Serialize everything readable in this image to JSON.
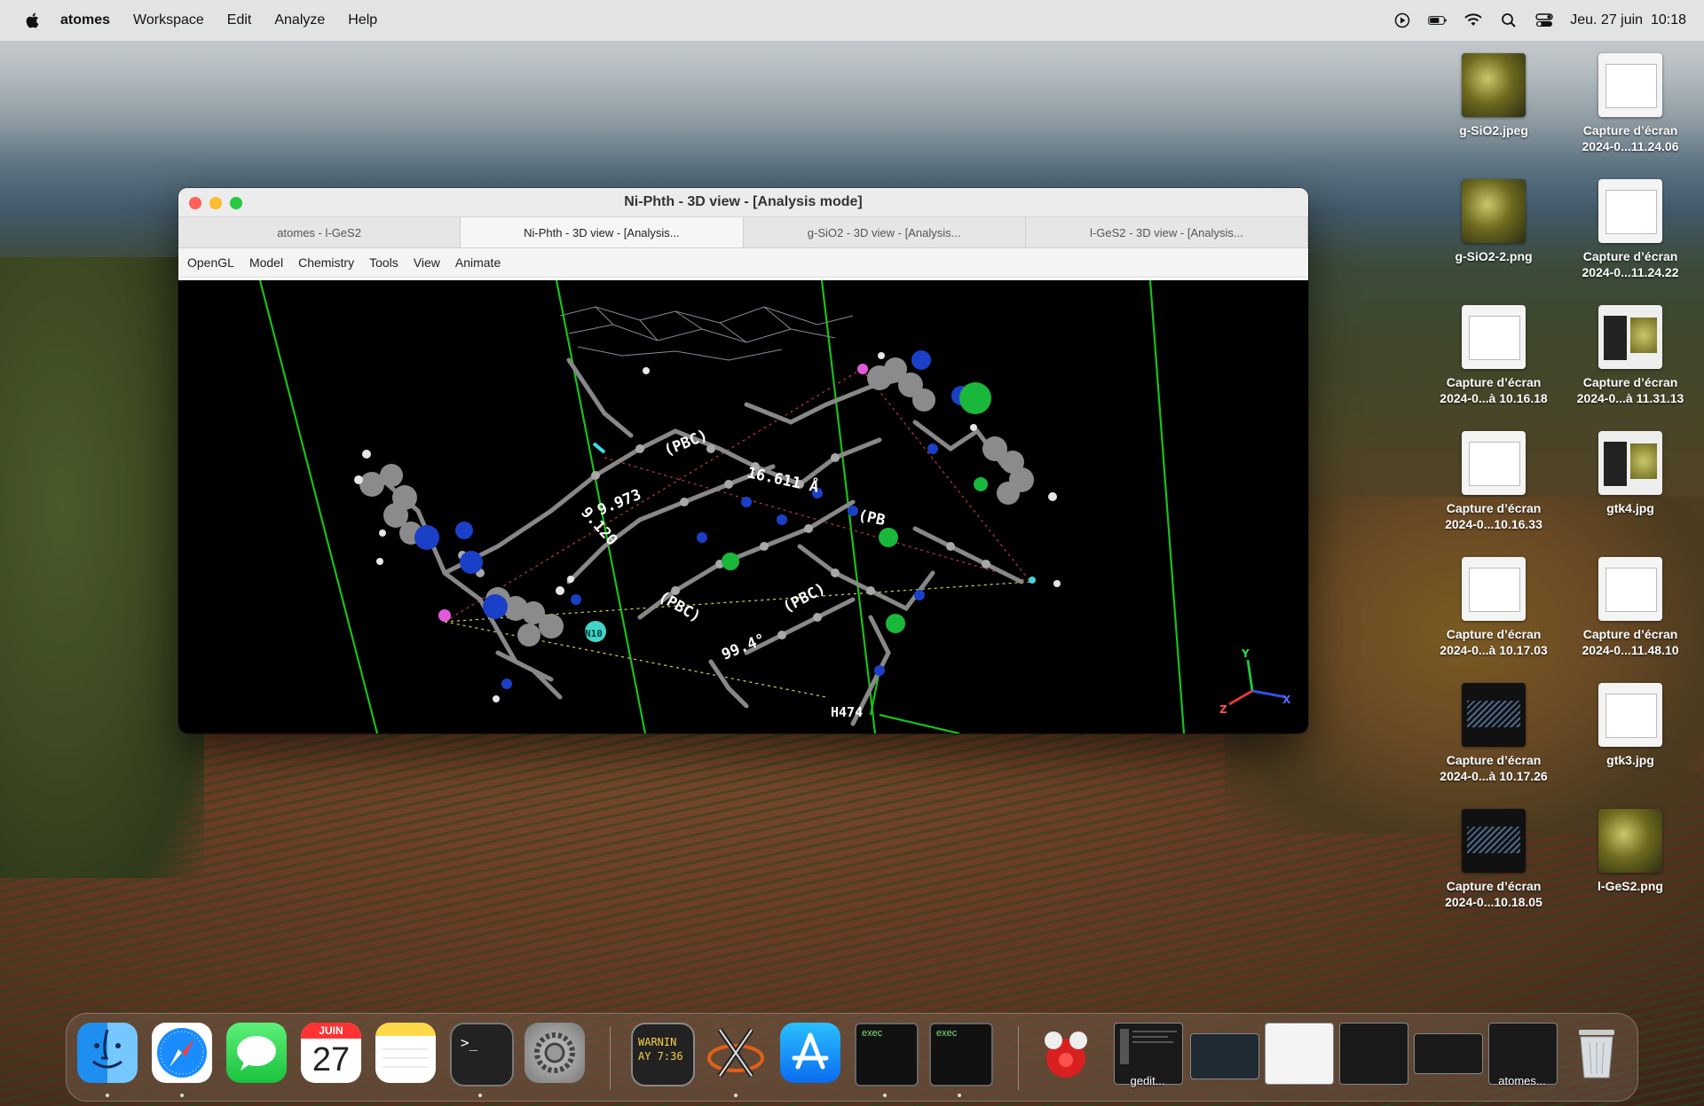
{
  "menubar": {
    "app_name": "atomes",
    "items": [
      "Workspace",
      "Edit",
      "Analyze",
      "Help"
    ],
    "datetime": "Jeu. 27 juin  10:18"
  },
  "window": {
    "title": "Ni-Phth - 3D view - [Analysis mode]",
    "tabs": [
      "atomes - l-GeS2",
      "Ni-Phth - 3D view - [Analysis...",
      "g-SiO2 - 3D view - [Analysis...",
      "l-GeS2 - 3D view - [Analysis..."
    ],
    "active_tab": 1,
    "menu": [
      "OpenGL",
      "Model",
      "Chemistry",
      "Tools",
      "View",
      "Animate"
    ],
    "labels": {
      "dist1": "16.611 Å",
      "pbc1": "(PBC)",
      "pbc2": "(PBC)",
      "pbc3": "(PBC)",
      "pbc4": "(PB",
      "angle1": "99.4°",
      "val1": "9.973",
      "val2": "9.120",
      "atom_h": "H474",
      "atom_n": "N10"
    },
    "axes": {
      "x": "X",
      "y": "Y",
      "z": "Z"
    }
  },
  "desktop_icons": [
    {
      "name": "g-SiO2.jpeg",
      "line2": "",
      "kind": "mol"
    },
    {
      "name": "Capture d’écran",
      "line2": "2024-0...11.24.06",
      "kind": "shot"
    },
    {
      "name": "g-SiO2-2.png",
      "line2": "",
      "kind": "mol"
    },
    {
      "name": "Capture d’écran",
      "line2": "2024-0...11.24.22",
      "kind": "shot"
    },
    {
      "name": "Capture d’écran",
      "line2": "2024-0...à 10.16.18",
      "kind": "shot"
    },
    {
      "name": "Capture d’écran",
      "line2": "2024-0...à 11.31.13",
      "kind": "gt"
    },
    {
      "name": "Capture d’écran",
      "line2": "2024-0...10.16.33",
      "kind": "shot"
    },
    {
      "name": "gtk4.jpg",
      "line2": "",
      "kind": "gt"
    },
    {
      "name": "Capture d’écran",
      "line2": "2024-0...à 10.17.03",
      "kind": "shot"
    },
    {
      "name": "Capture d’écran",
      "line2": "2024-0...11.48.10",
      "kind": "shot"
    },
    {
      "name": "Capture d’écran",
      "line2": "2024-0...à 10.17.26",
      "kind": "dark"
    },
    {
      "name": "gtk3.jpg",
      "line2": "",
      "kind": "shot"
    },
    {
      "name": "Capture d’écran",
      "line2": "2024-0...10.18.05",
      "kind": "dark"
    },
    {
      "name": "l-GeS2.png",
      "line2": "",
      "kind": "mol"
    }
  ],
  "dock": {
    "calendar_month": "JUIN",
    "calendar_day": "27",
    "console_text_1": "WARNIN",
    "console_text_2": "AY 7:36",
    "exec_label_1": "exec",
    "exec_label_2": "exec",
    "gedit_label": "gedit...",
    "atomes_label": "atomes..."
  }
}
